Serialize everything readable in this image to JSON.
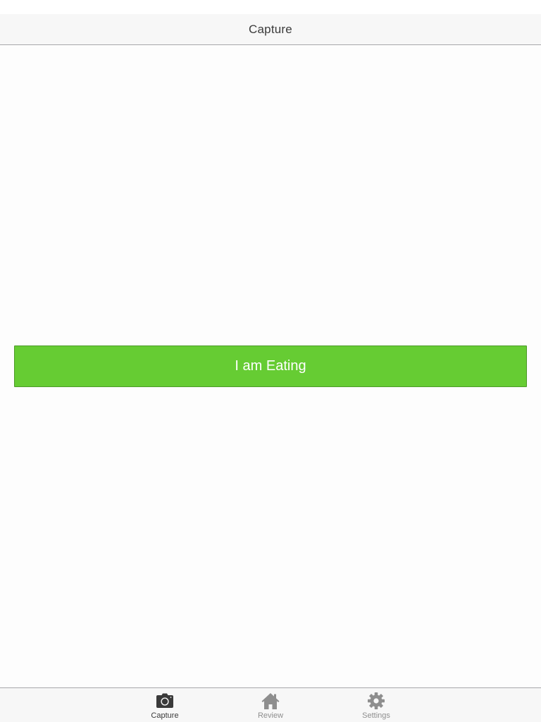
{
  "nav": {
    "title": "Capture"
  },
  "main": {
    "eat_button_label": "I am Eating",
    "eat_button_color": "#66cc33"
  },
  "tabs": [
    {
      "label": "Capture",
      "icon": "camera-icon",
      "selected": true
    },
    {
      "label": "Review",
      "icon": "home-icon",
      "selected": false
    },
    {
      "label": "Settings",
      "icon": "gear-icon",
      "selected": false
    }
  ]
}
